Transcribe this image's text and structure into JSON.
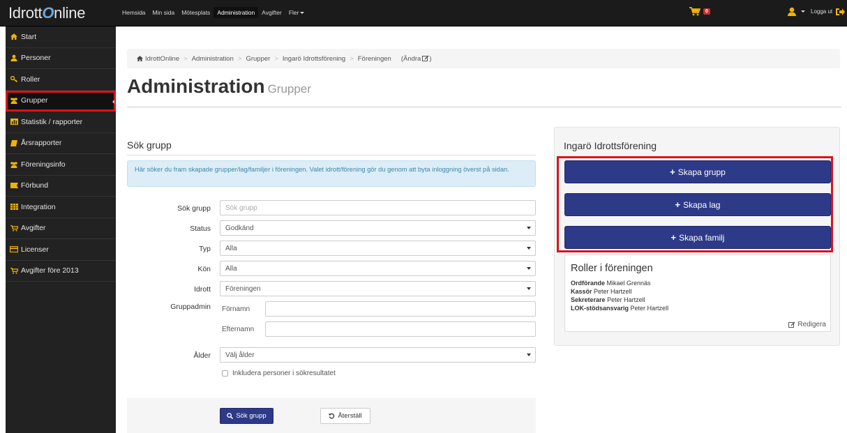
{
  "brand": {
    "part1": "Idrott",
    "part2": "O",
    "part3": "nline"
  },
  "topnav": {
    "items": [
      "Hemsida",
      "Min sida",
      "Mötesplats",
      "Administration",
      "Avgifter",
      "Fler"
    ],
    "cart_count": "0",
    "logout": "Logga ut"
  },
  "sidebar": {
    "items": [
      {
        "label": "Start",
        "icon": "home-icon"
      },
      {
        "label": "Personer",
        "icon": "user-icon"
      },
      {
        "label": "Roller",
        "icon": "key-icon"
      },
      {
        "label": "Grupper",
        "icon": "group-icon"
      },
      {
        "label": "Statistik / rapporter",
        "icon": "chart-icon"
      },
      {
        "label": "Årsrapporter",
        "icon": "book-icon"
      },
      {
        "label": "Föreningsinfo",
        "icon": "group-icon"
      },
      {
        "label": "Förbund",
        "icon": "flag-icon"
      },
      {
        "label": "Integration",
        "icon": "table-icon"
      },
      {
        "label": "Avgifter",
        "icon": "cart-icon"
      },
      {
        "label": "Licenser",
        "icon": "card-icon"
      },
      {
        "label": "Avgifter före 2013",
        "icon": "cart-icon"
      }
    ]
  },
  "breadcrumb": {
    "items": [
      "IdrottOnline",
      "Administration",
      "Grupper",
      "Ingarö Idrottsförening",
      "Föreningen"
    ],
    "edit": "(Ändra"
  },
  "page": {
    "title": "Administration",
    "subtitle": "Grupper"
  },
  "search": {
    "title": "Sök grupp",
    "info": "Här söker du fram skapade grupper/lag/familjer i föreningen. Valet idrott/förening gör du genom att byta inloggning överst på sidan.",
    "fields": {
      "group_label": "Sök grupp",
      "group_placeholder": "Sök grupp",
      "status_label": "Status",
      "status_value": "Godkänd",
      "type_label": "Typ",
      "type_value": "Alla",
      "gender_label": "Kön",
      "gender_value": "Alla",
      "sport_label": "Idrott",
      "sport_value": "Föreningen",
      "admin_label": "Gruppadmin",
      "firstname_label": "Förnamn",
      "lastname_label": "Efternamn",
      "age_label": "Ålder",
      "age_value": "Välj ålder"
    },
    "include_persons": "Inkludera personer i sökresultatet",
    "search_button": "Sök grupp",
    "reset_button": "Återställ"
  },
  "club": {
    "name": "Ingarö Idrottsförening",
    "buttons": [
      "Skapa grupp",
      "Skapa lag",
      "Skapa familj"
    ],
    "roles_title": "Roller i föreningen",
    "roles": [
      {
        "role": "Ordförande",
        "name": "Mikael Grennäs"
      },
      {
        "role": "Kassör",
        "name": "Peter Hartzell"
      },
      {
        "role": "Sekreterare",
        "name": "Peter Hartzell"
      },
      {
        "role": "LOK-stödsansvarig",
        "name": "Peter Hartzell"
      }
    ],
    "edit": "Redigera"
  },
  "colors": {
    "primary": "#2d3a88",
    "highlight": "#d9141e",
    "sidebar": "#222222",
    "topbar": "#1b1b1b"
  }
}
